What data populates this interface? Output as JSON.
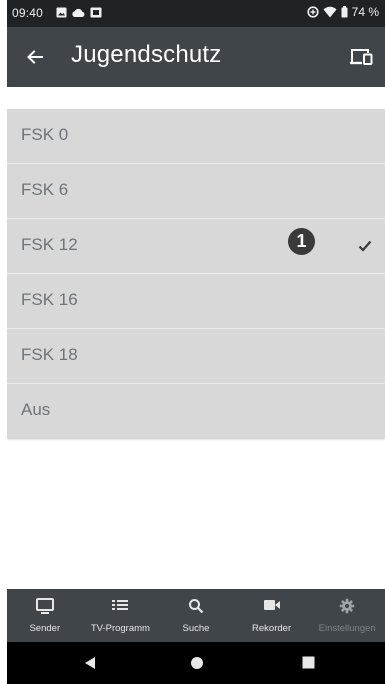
{
  "status_bar": {
    "time": "09:40",
    "battery": "74 %"
  },
  "app_bar": {
    "title": "Jugendschutz"
  },
  "list": {
    "items": [
      {
        "label": "FSK 0",
        "selected": false
      },
      {
        "label": "FSK 6",
        "selected": false
      },
      {
        "label": "FSK 12",
        "selected": true
      },
      {
        "label": "FSK 16",
        "selected": false
      },
      {
        "label": "FSK 18",
        "selected": false
      },
      {
        "label": "Aus",
        "selected": false
      }
    ]
  },
  "callout": {
    "number": "1"
  },
  "bottom_nav": {
    "items": [
      {
        "label": "Sender",
        "icon": "tv-icon"
      },
      {
        "label": "TV-Programm",
        "icon": "list-icon"
      },
      {
        "label": "Suche",
        "icon": "search-icon"
      },
      {
        "label": "Rekorder",
        "icon": "video-camera-icon"
      },
      {
        "label": "Einstellungen",
        "icon": "gear-icon",
        "disabled": true
      }
    ]
  },
  "colors": {
    "status_bar": "#1f2326",
    "app_bar": "#3f4549",
    "list_bg": "#d8d8d8",
    "list_text": "#6f7478",
    "callout": "#3a3a3a"
  }
}
